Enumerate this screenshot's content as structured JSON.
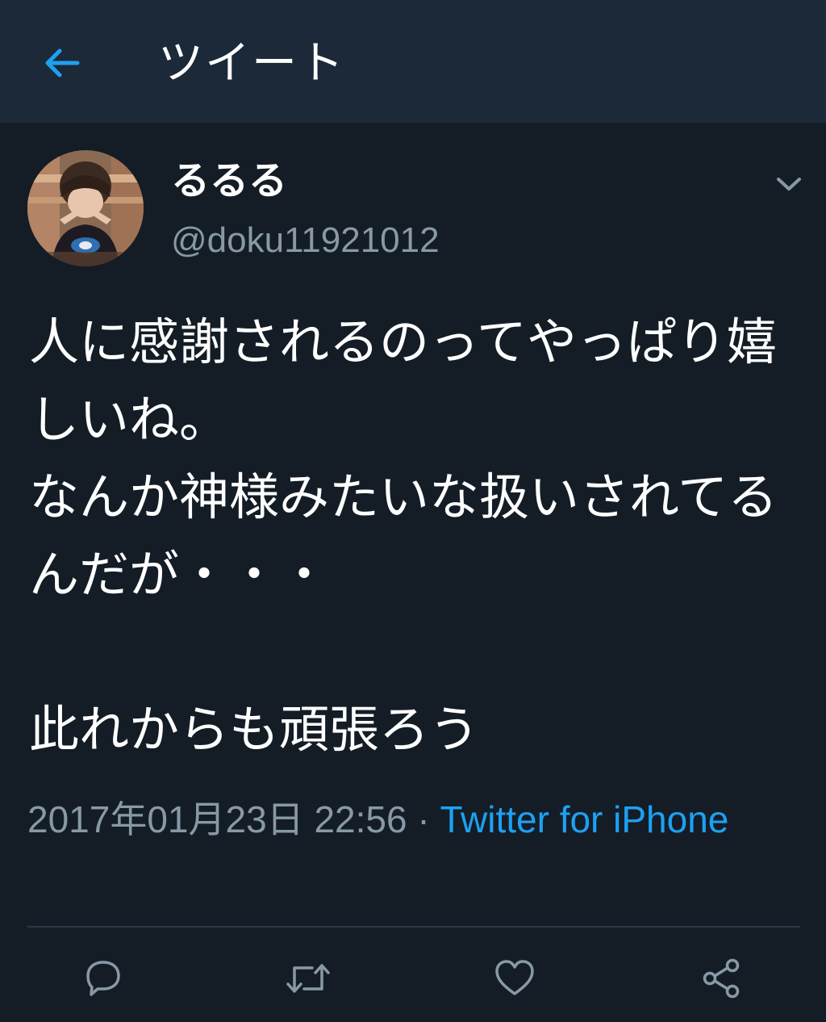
{
  "header": {
    "title": "ツイート",
    "back_icon": "arrow-left-icon"
  },
  "tweet": {
    "display_name": "るるる",
    "handle": "@doku11921012",
    "text": "人に感謝されるのってやっぱり嬉しいね。\nなんか神様みたいな扱いされてるんだが・・・\n\n此れからも頑張ろう",
    "timestamp": "2017年01月23日 22:56",
    "separator": " · ",
    "source": "Twitter for iPhone"
  },
  "actions": {
    "reply_icon": "reply-icon",
    "retweet_icon": "retweet-icon",
    "like_icon": "heart-icon",
    "share_icon": "share-icon"
  },
  "colors": {
    "background": "#141d26",
    "header_background": "#1c2938",
    "accent": "#1da1f2",
    "secondary_text": "#8899a6",
    "primary_text": "#ffffff"
  }
}
